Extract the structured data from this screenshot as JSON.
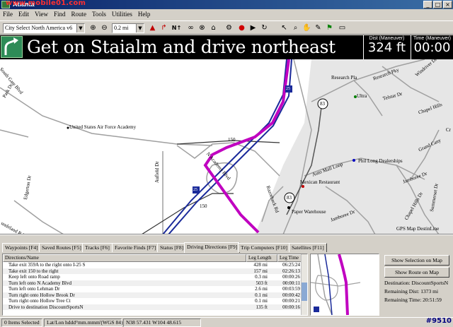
{
  "watermark": "www.mobile01.com",
  "window": {
    "title": "Atlanta",
    "minimize": "_",
    "maximize": "□",
    "close": "×"
  },
  "menu": [
    "File",
    "Edit",
    "View",
    "Find",
    "Route",
    "Tools",
    "Utilities",
    "Help"
  ],
  "toolbar": {
    "map_select": "City Select North America v6",
    "zoom_select": "0.2 mi"
  },
  "banner": {
    "instruction": "Get on Staialm and drive northeast",
    "dist_label": "Dist (Maneuver)",
    "dist_value": "324 ft",
    "time_label": "Time (Maneuver)",
    "time_value": "00:00"
  },
  "map": {
    "labels": {
      "south_gate": "South Gate Blvd",
      "park_dr": "Park Dr",
      "usaf": "United States Air Force Academy",
      "research_pkwy": "Research Pky",
      "research_pla": "Research Pla",
      "telstar": "Telstar Dr",
      "chapel_hills": "Chapel Hills",
      "grand_canyon": "Grand Cany",
      "jamboree": "Jamboree Dr",
      "jamboree2": "Jamboree Dr",
      "auto_mall": "Auto Mall Loop",
      "phil_long": "Phil Long Dealerships",
      "r150a": "150",
      "r150b": "150",
      "n_academy": "N Academy Blvd",
      "aufield": "Aufield Dr",
      "edgerton": "Edgerton Dr",
      "razorback": "Razorback Rd",
      "paper_warehouse": "Paper Warehouse",
      "mexican": "Mexican Restaurant",
      "summerset": "Summerset Dr",
      "chapel_hills2": "Chapel Hills Dr",
      "gps_status": "GPS Map DestinLine",
      "ultra": "Ultra",
      "windriver": "Windriver Dr",
      "c_dr": "Cr",
      "undeland": "undeland Rd"
    },
    "shields": {
      "s83a": "83",
      "s83b": "83",
      "i25a": "25",
      "i25b": "25"
    }
  },
  "tabs": [
    "Waypoints [F4]",
    "Saved Routes [F5]",
    "Tracks [F6]",
    "Favorite Finds [F7]",
    "Status [F8]",
    "Driving Directions [F9]",
    "Trip Computers [F10]",
    "Satellites [F11]"
  ],
  "directions": {
    "headers": {
      "name": "Directions/Name",
      "length": "Leg Length",
      "time": "Leg Time"
    },
    "rows": [
      {
        "name": "Take exit 359A to the right onto I-25 S",
        "length": "428 mi",
        "time": "06:25:24"
      },
      {
        "name": "Take exit 150 to the right",
        "length": "157 mi",
        "time": "02:26:13"
      },
      {
        "name": "Keep left onto Road ramp",
        "length": "0.3 mi",
        "time": "00:00:26"
      },
      {
        "name": "Turn left onto N Academy Blvd",
        "length": "503 ft",
        "time": "00:00:11"
      },
      {
        "name": "Turn left onto Lehman Dr",
        "length": "2.6 mi",
        "time": "00:03:59"
      },
      {
        "name": "Turn right onto Hollow Brook Dr",
        "length": "0.1 mi",
        "time": "00:00:42"
      },
      {
        "name": "Turn right onto Hollow Tree Ct",
        "length": "0.1 mi",
        "time": "00:00:21"
      },
      {
        "name": "Drive to destination DiscountSportsN",
        "length": "135 ft",
        "time": "00:00:16"
      }
    ]
  },
  "sidepanel": {
    "show_selection": "Show Selection on Map",
    "show_route": "Show Route on Map",
    "destination": "Destination: DiscountSportsN",
    "remaining_dist": "Remaining Dist: 1373 mi",
    "remaining_time": "Remaining Time: 20:51:59"
  },
  "status": {
    "items_selected": "0 Items Selected",
    "format": "Lat/Lon hddd°mm.mmm'(WGS 84)",
    "coords": "N38 57.431 W104 48.615",
    "stamp": "#9510"
  },
  "colors": {
    "route": "#c000c0",
    "interstate": "#1a2a9a",
    "banner_bg": "#000000",
    "chrome": "#d4d0c8"
  }
}
